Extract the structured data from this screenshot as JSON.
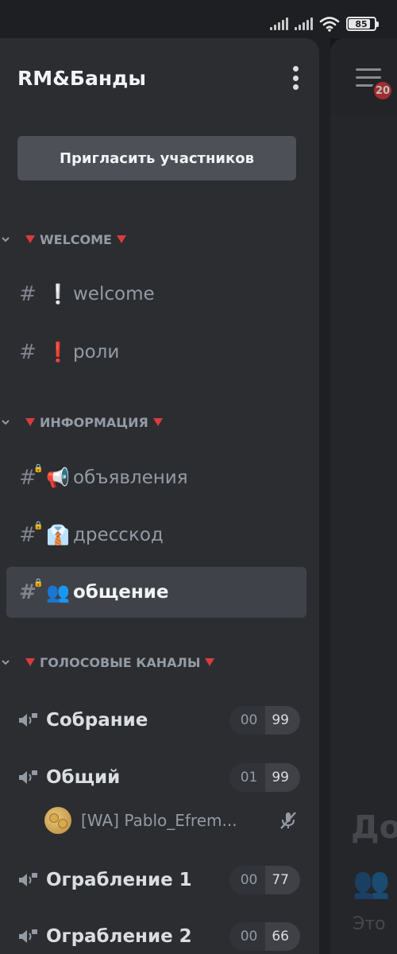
{
  "status_bar": {
    "battery": "85",
    "battery_level": 0.85
  },
  "server": {
    "name": "RM&Банды",
    "invite_label": "Пригласить участников"
  },
  "categories": [
    {
      "name": "WELCOME"
    },
    {
      "name": "ИНФОРМАЦИЯ"
    },
    {
      "name": "ГОЛОСОВЫЕ КАНАЛЫ"
    }
  ],
  "channels": [
    {
      "emoji": "❕",
      "name": "welcome",
      "emoji_icon": "white-exclamation-icon"
    },
    {
      "emoji": "❗",
      "name": "роли",
      "emoji_icon": "red-exclamation-icon"
    },
    {
      "emoji": "📢",
      "name": "объявления",
      "emoji_icon": "megaphone-icon"
    },
    {
      "emoji": "👔",
      "name": "дресскод",
      "emoji_icon": "shirt-tie-icon"
    },
    {
      "emoji": "👥",
      "name": "общение",
      "emoji_icon": "people-icon",
      "active": true
    }
  ],
  "voice_channels": [
    {
      "name": "Собрание",
      "current": "00",
      "max": "99"
    },
    {
      "name": "Общий",
      "current": "01",
      "max": "99"
    },
    {
      "name": "Ограбление 1",
      "current": "00",
      "max": "77"
    },
    {
      "name": "Ограбление 2",
      "current": "00",
      "max": "66"
    }
  ],
  "voice_user": {
    "name": "[WA] Pablo_Efrem..."
  },
  "content": {
    "badge": "20",
    "title": "До",
    "text": "Это"
  },
  "colors": {
    "background": "#1e1f22",
    "panel": "#2b2d31",
    "active_channel": "#404249",
    "accent_red": "#d83c3e",
    "button": "#4e5058"
  }
}
